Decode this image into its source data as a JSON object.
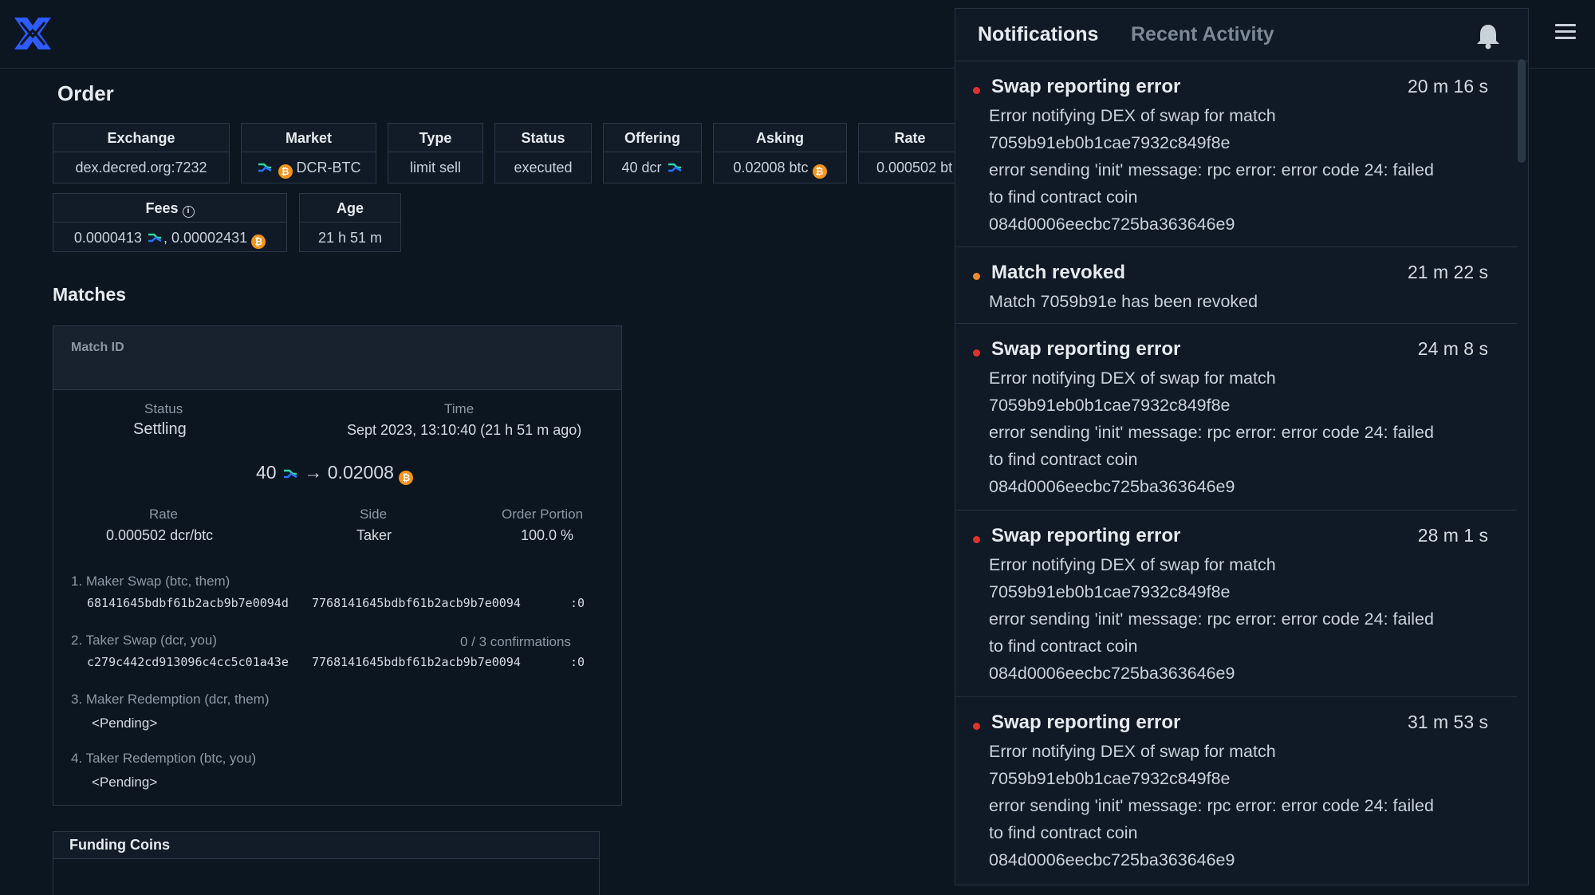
{
  "order": {
    "title": "Order",
    "row1": [
      {
        "header": "Exchange",
        "value": "dex.decred.org:7232"
      },
      {
        "header": "Market",
        "value": "DCR-BTC"
      },
      {
        "header": "Type",
        "value": "limit sell"
      },
      {
        "header": "Status",
        "value": "executed"
      },
      {
        "header": "Offering",
        "value": "40 dcr"
      },
      {
        "header": "Asking",
        "value": "0.02008 btc"
      },
      {
        "header": "Rate",
        "value": "0.000502 bt"
      }
    ],
    "fees": {
      "header": "Fees",
      "value_dcr": "0.0000413",
      "separator": ",",
      "value_btc": "0.00002431"
    },
    "age": {
      "header": "Age",
      "value": "21 h 51 m"
    }
  },
  "matches": {
    "title": "Matches",
    "match_id_label": "Match ID",
    "status_label": "Status",
    "status_value": "Settling",
    "time_label": "Time",
    "time_value": "Sept 2023, 13:10:40 (21 h 51 m ago)",
    "amount_from": "40",
    "arrow": "→",
    "amount_to": "0.02008",
    "rate_label": "Rate",
    "rate_value": "0.000502 dcr/btc",
    "side_label": "Side",
    "side_value": "Taker",
    "portion_label": "Order Portion",
    "portion_value": "100.0 %",
    "steps": [
      {
        "label": "1. Maker Swap (btc, them)",
        "coin": "68141645bdbf61b2acb9b7e0094d",
        "tx": "7768141645bdbf61b2acb9b7e0094",
        "vout": ":0",
        "confirmations": ""
      },
      {
        "label": "2. Taker Swap (dcr, you)",
        "coin": "c279c442cd913096c4cc5c01a43e",
        "tx": "7768141645bdbf61b2acb9b7e0094",
        "vout": ":0",
        "confirmations": "0 / 3 confirmations"
      },
      {
        "label": "3. Maker Redemption (dcr, them)",
        "pending": "<Pending>"
      },
      {
        "label": "4. Taker Redemption (btc, you)",
        "pending": "<Pending>"
      }
    ]
  },
  "funding": {
    "title": "Funding Coins"
  },
  "notifications": {
    "tab_notifications": "Notifications",
    "tab_recent": "Recent Activity",
    "items": [
      {
        "title": "Swap reporting error",
        "time": "20 m 16 s",
        "dot_color": "#e0312f",
        "lines": [
          "Error notifying DEX of swap for match",
          "7059b91eb0b1cae7932c849f8e",
          "error sending 'init' message: rpc error: error code 24: failed",
          "to find contract coin",
          "084d0006eecbc725ba363646e9"
        ]
      },
      {
        "title": "Match revoked",
        "time": "21 m 22 s",
        "dot_color": "#f08a24",
        "lines": [
          "Match 7059b91e has been revoked"
        ]
      },
      {
        "title": "Swap reporting error",
        "time": "24 m 8 s",
        "dot_color": "#e0312f",
        "lines": [
          "Error notifying DEX of swap for match",
          "7059b91eb0b1cae7932c849f8e",
          "error sending 'init' message: rpc error: error code 24: failed",
          "to find contract coin",
          "084d0006eecbc725ba363646e9"
        ]
      },
      {
        "title": "Swap reporting error",
        "time": "28 m 1 s",
        "dot_color": "#e0312f",
        "lines": [
          "Error notifying DEX of swap for match",
          "7059b91eb0b1cae7932c849f8e",
          "error sending 'init' message: rpc error: error code 24: failed",
          "to find contract coin",
          "084d0006eecbc725ba363646e9"
        ]
      },
      {
        "title": "Swap reporting error",
        "time": "31 m 53 s",
        "dot_color": "#e0312f",
        "lines": [
          "Error notifying DEX of swap for match",
          "7059b91eb0b1cae7932c849f8e",
          "error sending 'init' message: rpc error: error code 24: failed",
          "to find contract coin",
          "084d0006eecbc725ba363646e9"
        ]
      }
    ]
  },
  "colors": {
    "accent_blue": "#2970ff",
    "btc_orange": "#f7931a",
    "dcr_teal": "#2ed6a1"
  }
}
